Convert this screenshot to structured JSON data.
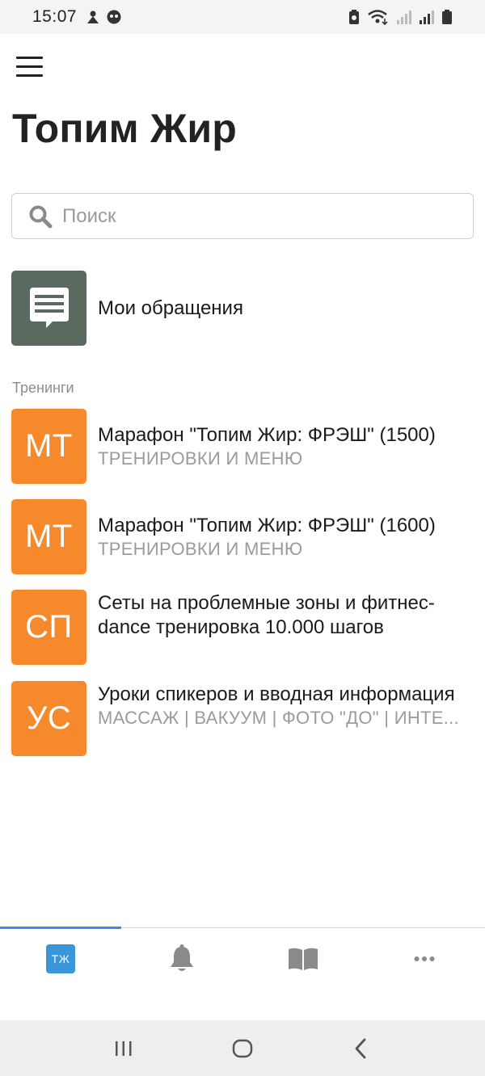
{
  "status_bar": {
    "time": "15:07"
  },
  "header": {
    "title": "Топим Жир"
  },
  "search": {
    "placeholder": "Поиск"
  },
  "my_requests": {
    "label": "Мои обращения"
  },
  "section": {
    "label": "Тренинги"
  },
  "trainings": [
    {
      "initials": "МТ",
      "title": "Марафон \"Топим Жир: ФРЭШ\" (1500)",
      "subtitle": "ТРЕНИРОВКИ И МЕНЮ"
    },
    {
      "initials": "МТ",
      "title": "Марафон \"Топим Жир: ФРЭШ\" (1600)",
      "subtitle": "ТРЕНИРОВКИ И МЕНЮ"
    },
    {
      "initials": "СП",
      "title": "Сеты на проблемные зоны и фитнес-dance тренировка 10.000 шагов",
      "subtitle": ""
    },
    {
      "initials": "УС",
      "title": "Уроки спикеров и вводная информация",
      "subtitle": "МАССАЖ | ВАКУУМ | ФОТО \"ДО\" | ИНТЕ..."
    }
  ],
  "tabbar": {
    "home_logo": "ТЖ",
    "tabs": [
      "home-tab",
      "notifications-tab",
      "library-tab",
      "more-tab"
    ]
  },
  "colors": {
    "accent_orange": "#f5892b",
    "chat_tile": "#5b6a60",
    "tab_blue": "#3b95db"
  }
}
